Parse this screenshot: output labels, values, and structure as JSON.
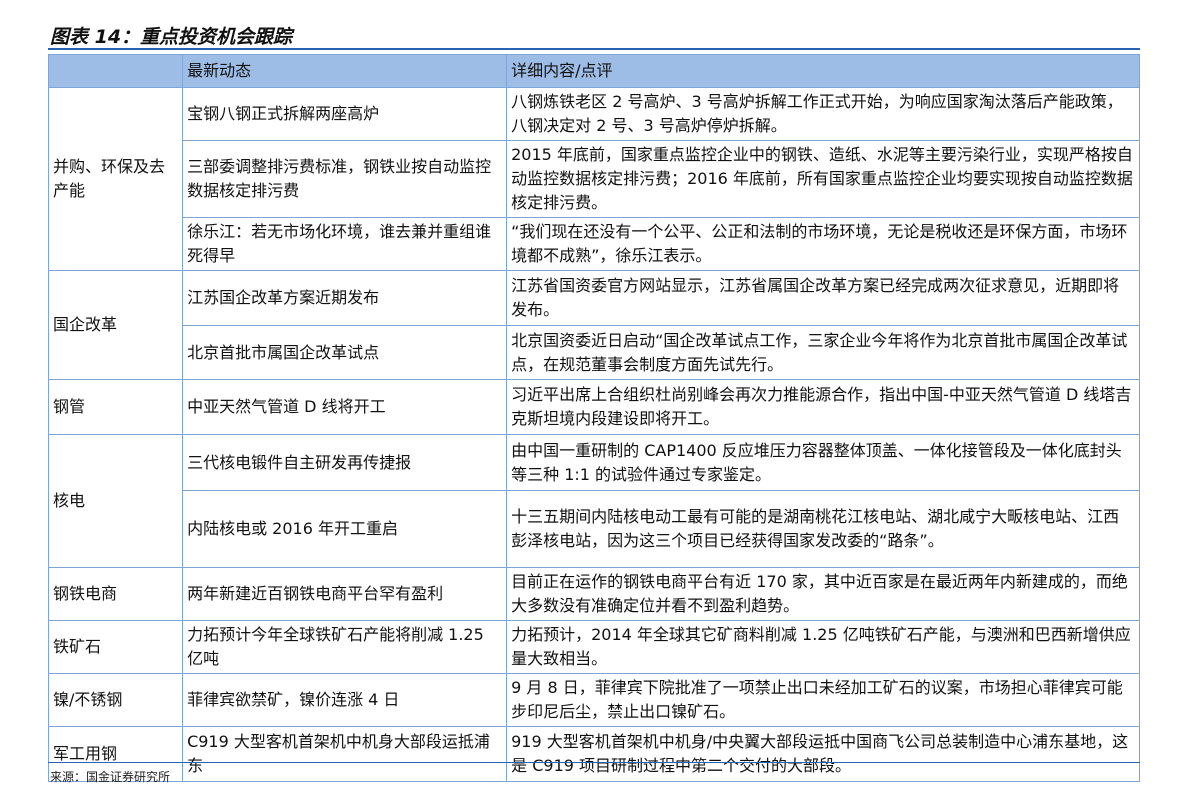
{
  "title": "图表 14：重点投资机会跟踪",
  "header": {
    "col1": "",
    "col2": "最新动态",
    "col3": "详细内容/点评"
  },
  "groups": [
    {
      "name": "并购、环保及去产能",
      "rows": [
        {
          "news": "宝钢八钢正式拆解两座高炉",
          "detail": "八钢炼铁老区 2 号高炉、3 号高炉拆解工作正式开始，为响应国家淘汰落后产能政策，八钢决定对 2 号、3 号高炉停炉拆解。"
        },
        {
          "news": "三部委调整排污费标准，钢铁业按自动监控数据核定排污费",
          "detail": "2015 年底前，国家重点监控企业中的钢铁、造纸、水泥等主要污染行业，实现严格按自动监控数据核定排污费；2016 年底前，所有国家重点监控企业均要实现按自动监控数据核定排污费。"
        },
        {
          "news": "徐乐江：若无市场化环境，谁去兼并重组谁死得早",
          "detail": "“我们现在还没有一个公平、公正和法制的市场环境，无论是税收还是环保方面，市场环境都不成熟”，徐乐江表示。"
        }
      ]
    },
    {
      "name": "国企改革",
      "rows": [
        {
          "news": "江苏国企改革方案近期发布",
          "detail": "江苏省国资委官方网站显示，江苏省属国企改革方案已经完成两次征求意见，近期即将发布。"
        },
        {
          "news": "北京首批市属国企改革试点",
          "detail": "北京国资委近日启动“国企改革试点工作，三家企业今年将作为北京首批市属国企改革试点，在规范董事会制度方面先试先行。"
        }
      ]
    },
    {
      "name": "钢管",
      "rows": [
        {
          "news": "中亚天然气管道 D 线将开工",
          "detail": "习近平出席上合组织杜尚别峰会再次力推能源合作，指出中国-中亚天然气管道 D 线塔吉克斯坦境内段建设即将开工。"
        }
      ]
    },
    {
      "name": "核电",
      "rows": [
        {
          "news": "三代核电锻件自主研发再传捷报",
          "detail": "由中国一重研制的 CAP1400 反应堆压力容器整体顶盖、一体化接管段及一体化底封头等三种 1:1 的试验件通过专家鉴定。"
        },
        {
          "news": "内陆核电或 2016 年开工重启",
          "detail": "十三五期间内陆核电动工最有可能的是湖南桃花江核电站、湖北咸宁大畈核电站、江西彭泽核电站，因为这三个项目已经获得国家发改委的“路条”。"
        }
      ]
    },
    {
      "name": "钢铁电商",
      "rows": [
        {
          "news": "两年新建近百钢铁电商平台罕有盈利",
          "detail": "目前正在运作的钢铁电商平台有近 170 家，其中近百家是在最近两年内新建成的，而绝大多数没有准确定位并看不到盈利趋势。"
        }
      ]
    },
    {
      "name": "铁矿石",
      "rows": [
        {
          "news": "力拓预计今年全球铁矿石产能将削减 1.25 亿吨",
          "detail": "力拓预计，2014 年全球其它矿商料削减 1.25 亿吨铁矿石产能，与澳洲和巴西新增供应量大致相当。"
        }
      ]
    },
    {
      "name": "镍/不锈钢",
      "rows": [
        {
          "news": "菲律宾欲禁矿，镍价连涨 4 日",
          "detail": "9 月 8 日，菲律宾下院批准了一项禁止出口未经加工矿石的议案，市场担心菲律宾可能步印尼后尘，禁止出口镍矿石。"
        }
      ]
    },
    {
      "name": "军工用钢",
      "rows": [
        {
          "news": "C919 大型客机首架机中机身大部段运抵浦东",
          "detail": "919 大型客机首架机中机身/中央翼大部段运抵中国商飞公司总装制造中心浦东基地，这是 C919 项目研制过程中第二个交付的大部段。"
        }
      ]
    }
  ],
  "source": "来源：国金证券研究所"
}
